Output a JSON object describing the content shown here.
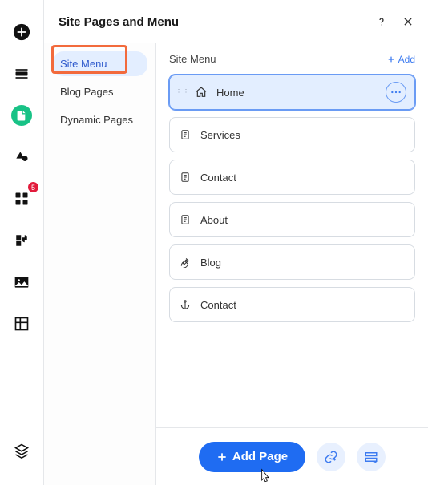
{
  "rail": {
    "items": [
      {
        "name": "add-icon"
      },
      {
        "name": "page-icon"
      },
      {
        "name": "document-icon",
        "active": true
      },
      {
        "name": "theme-icon"
      },
      {
        "name": "apps-icon",
        "badge": "5"
      },
      {
        "name": "plugin-icon"
      },
      {
        "name": "media-icon"
      },
      {
        "name": "layout-icon"
      }
    ],
    "bottom": {
      "name": "layers-icon"
    }
  },
  "header": {
    "title": "Site Pages and Menu"
  },
  "sidebar": {
    "items": [
      {
        "label": "Site Menu",
        "active": true
      },
      {
        "label": "Blog Pages"
      },
      {
        "label": "Dynamic Pages"
      }
    ]
  },
  "section": {
    "title": "Site Menu",
    "add_label": "Add"
  },
  "pages": [
    {
      "label": "Home",
      "icon": "home",
      "selected": true,
      "showGrip": true,
      "showMore": true
    },
    {
      "label": "Services",
      "icon": "doc"
    },
    {
      "label": "Contact",
      "icon": "doc"
    },
    {
      "label": "About",
      "icon": "doc"
    },
    {
      "label": "Blog",
      "icon": "pen"
    },
    {
      "label": "Contact",
      "icon": "anchor"
    }
  ],
  "footer": {
    "add_page_label": "Add Page"
  }
}
